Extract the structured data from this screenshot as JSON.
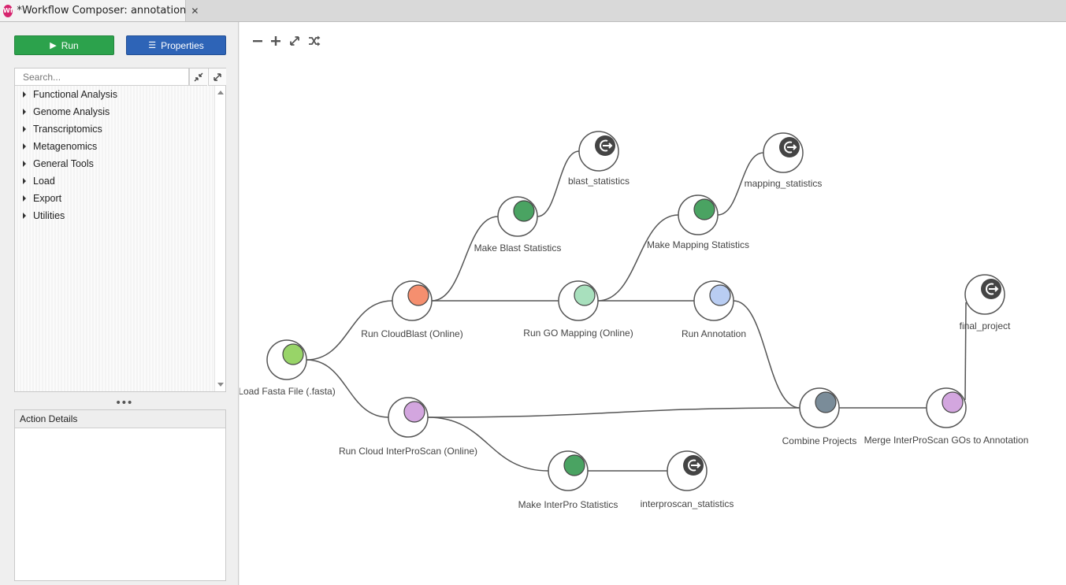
{
  "tab": {
    "icon_text": "Wf",
    "title": "*Workflow Composer: annotation"
  },
  "toolbar": {
    "run_label": "Run",
    "properties_label": "Properties"
  },
  "search": {
    "placeholder": "Search..."
  },
  "tree": {
    "items": [
      {
        "label": "Functional Analysis"
      },
      {
        "label": "Genome Analysis"
      },
      {
        "label": "Transcriptomics"
      },
      {
        "label": "Metagenomics"
      },
      {
        "label": "General Tools"
      },
      {
        "label": "Load"
      },
      {
        "label": "Export"
      },
      {
        "label": "Utilities"
      }
    ]
  },
  "details": {
    "title": "Action Details"
  },
  "canvas_tools": [
    "zoom-out-icon",
    "zoom-in-icon",
    "fit-icon",
    "shuffle-icon"
  ],
  "colors": {
    "green_dark": "#4aa362",
    "green_light": "#98d468",
    "salmon": "#f58f6f",
    "mint": "#a8e0bd",
    "blue_light": "#b9cdf2",
    "purple": "#d3a6df",
    "slate": "#7a8c99",
    "output": "#444444"
  },
  "nodes": [
    {
      "id": "load",
      "label": "Load Fasta File (.fasta)",
      "kind": "action",
      "color": "#98d468"
    },
    {
      "id": "cb",
      "label": "Run CloudBlast (Online)",
      "kind": "action",
      "color": "#f58f6f"
    },
    {
      "id": "ips",
      "label": "Run Cloud InterProScan (Online)",
      "kind": "action",
      "color": "#d3a6df"
    },
    {
      "id": "mbs",
      "label": "Make Blast Statistics",
      "kind": "action",
      "color": "#4aa362"
    },
    {
      "id": "bstat",
      "label": "blast_statistics",
      "kind": "output"
    },
    {
      "id": "go",
      "label": "Run GO Mapping (Online)",
      "kind": "action",
      "color": "#a8e0bd"
    },
    {
      "id": "mms",
      "label": "Make Mapping Statistics",
      "kind": "action",
      "color": "#4aa362"
    },
    {
      "id": "mstat",
      "label": "mapping_statistics",
      "kind": "output"
    },
    {
      "id": "ann",
      "label": "Run Annotation",
      "kind": "action",
      "color": "#b9cdf2"
    },
    {
      "id": "comb",
      "label": "Combine Projects",
      "kind": "action",
      "color": "#7a8c99"
    },
    {
      "id": "merge",
      "label": "Merge InterProScan GOs to Annotation",
      "kind": "action",
      "color": "#d3a6df"
    },
    {
      "id": "final",
      "label": "final_project",
      "kind": "output"
    },
    {
      "id": "mip",
      "label": "Make InterPro Statistics",
      "kind": "action",
      "color": "#4aa362"
    },
    {
      "id": "istat",
      "label": "interproscan_statistics",
      "kind": "output"
    }
  ],
  "edges": [
    [
      "load",
      "cb"
    ],
    [
      "load",
      "ips"
    ],
    [
      "cb",
      "mbs"
    ],
    [
      "mbs",
      "bstat"
    ],
    [
      "cb",
      "go"
    ],
    [
      "go",
      "mms"
    ],
    [
      "mms",
      "mstat"
    ],
    [
      "go",
      "ann"
    ],
    [
      "ann",
      "comb"
    ],
    [
      "ips",
      "comb"
    ],
    [
      "comb",
      "merge"
    ],
    [
      "merge",
      "final"
    ],
    [
      "ips",
      "mip"
    ],
    [
      "mip",
      "istat"
    ]
  ]
}
